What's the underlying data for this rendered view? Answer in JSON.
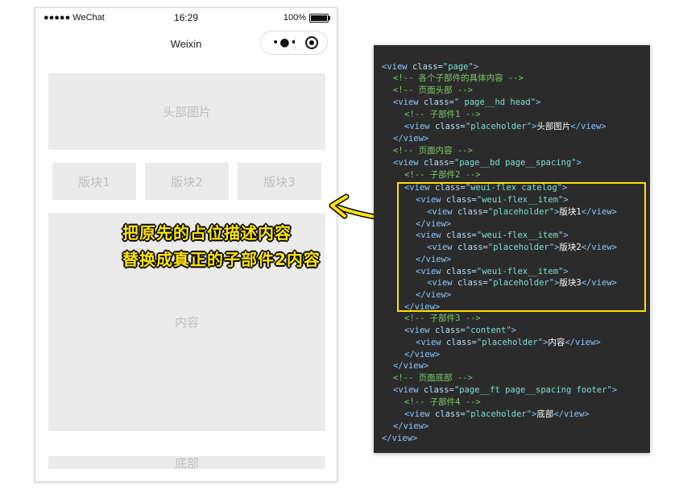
{
  "phone": {
    "status": {
      "carrier": "●●●●● WeChat",
      "time": "16:29",
      "battery": "100%"
    },
    "nav_title": "Weixin",
    "capsule": {
      "more_icon": "more-dots-icon",
      "close_icon": "record-target-icon"
    },
    "head_image": "头部图片",
    "blocks": [
      "版块1",
      "版块2",
      "版块3"
    ],
    "content": "内容",
    "footer": "底部"
  },
  "annotation": {
    "line1": "把原先的占位描述内容",
    "line2": "替换成真正的子部件2内容",
    "color": "#ffe600"
  },
  "code": {
    "l01": {
      "indent": "",
      "open": "<view ",
      "attr": "class=",
      "val": "\"page\"",
      "close": ">"
    },
    "l02": "<!-- 各个子部件的具体内容 -->",
    "l03": "<!-- 页面头部 -->",
    "l04": {
      "open": "<view ",
      "attr": "class=",
      "val": "\" page__hd head\"",
      "close": ">"
    },
    "l05": "<!-- 子部件1 -->",
    "l06": {
      "open": "<view ",
      "attr": "class=",
      "val": "\"placeholder\"",
      "close": ">",
      "text": "头部图片",
      "end": "</view>"
    },
    "l07": "</view>",
    "l08": "<!-- 页面内容 -->",
    "l09": {
      "open": "<view ",
      "attr": "class=",
      "val": "\"page__bd page__spacing\"",
      "close": ">"
    },
    "l10": "<!-- 子部件2 -->",
    "l11": {
      "open": "<view ",
      "attr": "class=",
      "val": "\"weui-flex catelog\"",
      "close": ">"
    },
    "l12": {
      "open": "<view ",
      "attr": "class=",
      "val": "\"weui-flex__item\"",
      "close": ">"
    },
    "l13": {
      "open": "<view ",
      "attr": "class=",
      "val": "\"placeholder\"",
      "close": ">",
      "text": "版块1",
      "end": "</view>"
    },
    "l14": "</view>",
    "l15": {
      "open": "<view ",
      "attr": "class=",
      "val": "\"weui-flex__item\"",
      "close": ">"
    },
    "l16": {
      "open": "<view ",
      "attr": "class=",
      "val": "\"placeholder\"",
      "close": ">",
      "text": "版块2",
      "end": "</view>"
    },
    "l17": "</view>",
    "l18": {
      "open": "<view ",
      "attr": "class=",
      "val": "\"weui-flex__item\"",
      "close": ">"
    },
    "l19": {
      "open": "<view ",
      "attr": "class=",
      "val": "\"placeholder\"",
      "close": ">",
      "text": "版块3",
      "end": "</view>"
    },
    "l20": "</view>",
    "l21": "</view>",
    "l22": "<!-- 子部件3 -->",
    "l23": {
      "open": "<view ",
      "attr": "class=",
      "val": "\"content\"",
      "close": ">"
    },
    "l24": {
      "open": "<view ",
      "attr": "class=",
      "val": "\"placeholder\"",
      "close": ">",
      "text": "内容",
      "end": "</view>"
    },
    "l25": "</view>",
    "l26": "</view>",
    "l27": "<!-- 页面底部 -->",
    "l28": {
      "open": "<view ",
      "attr": "class=",
      "val": "\"page__ft page__spacing footer\"",
      "close": ">"
    },
    "l29": "<!-- 子部件4 -->",
    "l30": {
      "open": "<view ",
      "attr": "class=",
      "val": "\"placeholder\"",
      "close": ">",
      "text": "底部",
      "end": "</view>"
    },
    "l31": "</view>",
    "l32": "</view>",
    "highlight_color": "#ffe000"
  }
}
